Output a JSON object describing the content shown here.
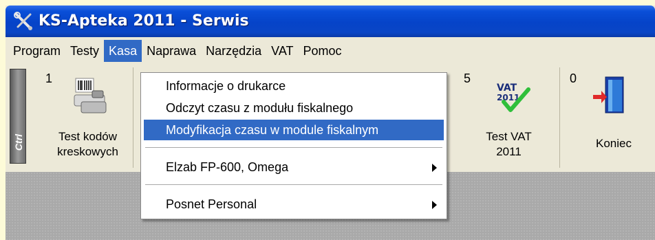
{
  "window": {
    "title": "KS-Apteka 2011 - Serwis",
    "icon": "tools-icon"
  },
  "menubar": {
    "items": [
      "Program",
      "Testy",
      "Kasa",
      "Naprawa",
      "Narzędzia",
      "VAT",
      "Pomoc"
    ],
    "active": "Kasa"
  },
  "toolbar": {
    "ctrl_label": "Ctrl",
    "buttons": [
      {
        "number": "1",
        "line1": "Test kodów",
        "line2": "kreskowych",
        "icon": "barcode-scanner-icon"
      },
      {
        "number": "5",
        "line1": "Test VAT",
        "line2": "2011",
        "icon": "vat-check-icon",
        "icon_text": "VAT 2011"
      },
      {
        "number": "0",
        "line1": "Koniec",
        "line2": "",
        "icon": "exit-door-icon"
      }
    ]
  },
  "kasa_menu": {
    "items": [
      {
        "label": "Informacje o drukarce",
        "submenu": false
      },
      {
        "label": "Odczyt czasu z modułu fiskalnego",
        "submenu": false
      },
      {
        "label": "Modyfikacja czasu w module fiskalnym",
        "submenu": false,
        "highlighted": true
      },
      {
        "label": "Elzab FP-600, Omega",
        "submenu": true
      },
      {
        "label": "Posnet Personal",
        "submenu": true
      }
    ]
  },
  "colors": {
    "titlebar": "#0543c8",
    "highlight": "#316ac5",
    "page_background": "#fdfbd8",
    "content_area": "#a9a9a9"
  }
}
